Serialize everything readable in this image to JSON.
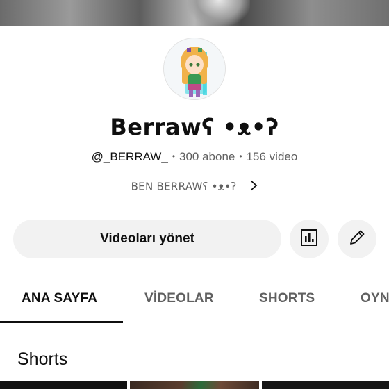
{
  "channel": {
    "name": "Berrawʕ •ᴥ•ʔ",
    "handle": "@_BERRAW_",
    "subscribers": "300 abone",
    "videos": "156 video",
    "description": "BEN BERRAWʕ •ᴥ•ʔ"
  },
  "actions": {
    "manage_videos_label": "Videoları yönet",
    "stats_icon": "bar-chart-icon",
    "edit_icon": "pencil-icon"
  },
  "tabs": [
    {
      "label": "ANA SAYFA",
      "active": true
    },
    {
      "label": "VİDEOLAR",
      "active": false
    },
    {
      "label": "SHORTS",
      "active": false
    },
    {
      "label": "OYN",
      "active": false
    }
  ],
  "sections": {
    "shorts_title": "Shorts"
  },
  "colors": {
    "text_primary": "#0f0f0f",
    "text_secondary": "#606060",
    "button_bg": "#f2f2f2",
    "divider": "#e5e5e5"
  }
}
